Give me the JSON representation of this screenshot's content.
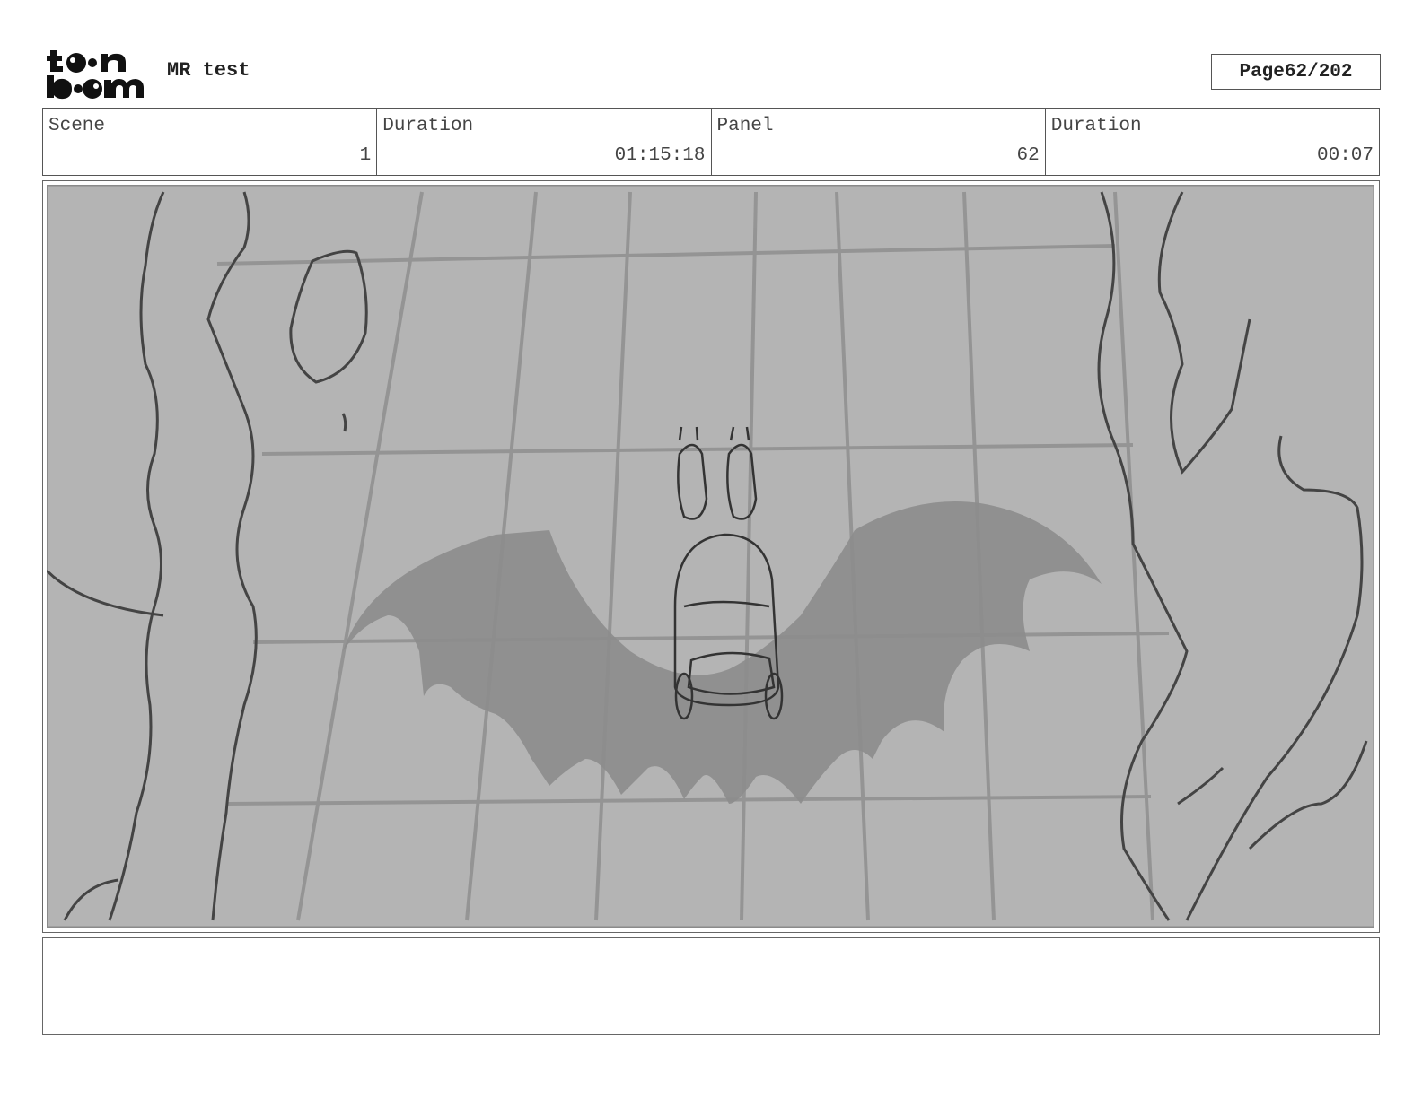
{
  "header": {
    "logo_text": "toon boom",
    "project_title": "MR test",
    "page_label": "Page",
    "page_value": "62/202"
  },
  "info": {
    "scene_label": "Scene",
    "scene_value": "1",
    "scene_duration_label": "Duration",
    "scene_duration_value": "01:15:18",
    "panel_label": "Panel",
    "panel_value": "62",
    "panel_duration_label": "Duration",
    "panel_duration_value": "00:07"
  },
  "panel": {
    "image": "storyboard sketch",
    "background_color": "#b4b4b4",
    "shadow_color": "#8c8c8c"
  },
  "notes": {
    "text": ""
  }
}
